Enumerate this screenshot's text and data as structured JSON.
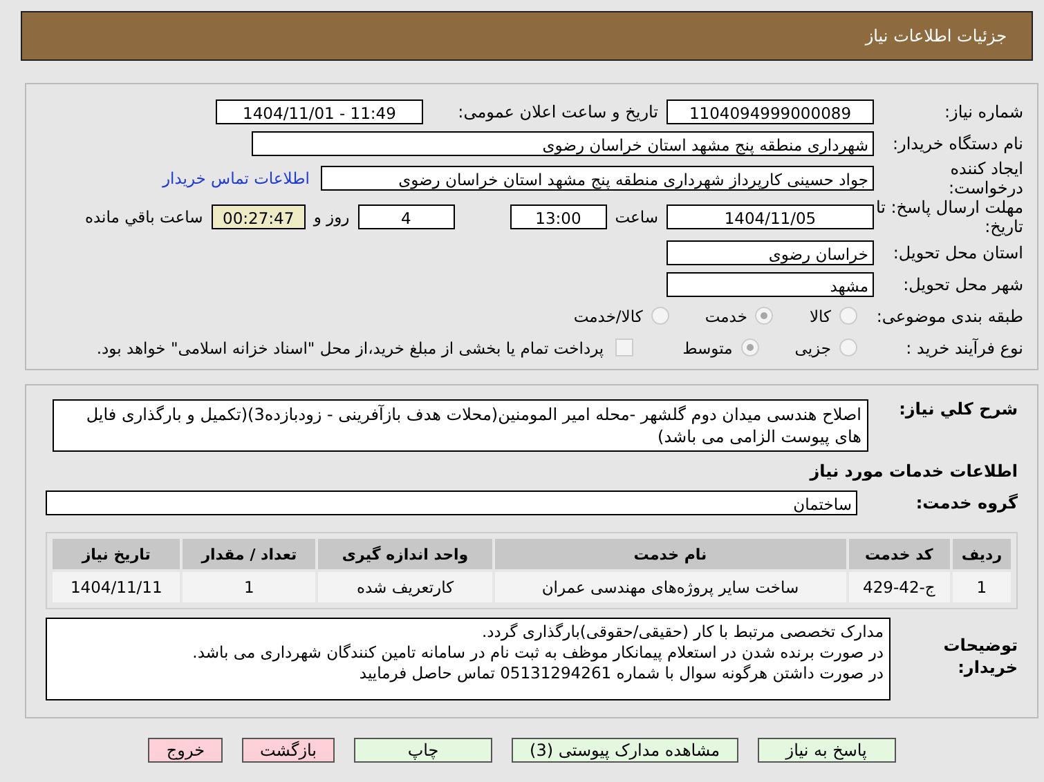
{
  "header": {
    "title": "جزئیات اطلاعات نیاز"
  },
  "info": {
    "need_number_label": "شماره نیاز:",
    "need_number": "1104094999000089",
    "announce_label": "تاریخ و ساعت اعلان عمومی:",
    "announce": "1404/11/01 - 11:49",
    "buyer_label": "نام دستگاه خریدار:",
    "buyer": "شهرداری منطقه پنج مشهد استان خراسان رضوی",
    "creator_label": "ایجاد کننده درخواست:",
    "creator": "جواد حسینی کارپرداز شهرداری منطقه پنج مشهد استان خراسان رضوی",
    "contact_link": "اطلاعات تماس خریدار",
    "deadline_label": "مهلت ارسال پاسخ: تا تاریخ:",
    "deadline_date": "1404/11/05",
    "time_label": "ساعت",
    "deadline_time": "13:00",
    "days": "4",
    "days_label": "روز و",
    "remaining": "00:27:47",
    "remaining_label": "ساعت باقي مانده",
    "province_label": "استان محل تحویل:",
    "province": "خراسان رضوی",
    "city_label": "شهر محل تحویل:",
    "city": "مشهد",
    "category_label": "طبقه بندی موضوعی:",
    "category_options": [
      {
        "label": "کالا",
        "selected": false
      },
      {
        "label": "خدمت",
        "selected": true
      },
      {
        "label": "کالا/خدمت",
        "selected": false
      }
    ],
    "purchase_label": "نوع فرآیند خرید :",
    "purchase_options": [
      {
        "label": "جزیی",
        "selected": false
      },
      {
        "label": "متوسط",
        "selected": true
      }
    ],
    "payment": {
      "checked": false,
      "text": "پرداخت تمام یا بخشی از مبلغ خرید،از محل \"اسناد خزانه اسلامی\" خواهد بود."
    }
  },
  "details": {
    "summary_label": "شرح کلي نیاز:",
    "summary": "اصلاح هندسی میدان دوم گلشهر -محله امیر المومنین(محلات هدف بازآفرینی - زودبازده3)(تکمیل و بارگذاری فایل های پیوست الزامی می باشد)",
    "services_heading": "اطلاعات خدمات مورد نیاز",
    "group_label": "گروه خدمت:",
    "group": "ساختمان",
    "table": {
      "columns": [
        "ردیف",
        "کد خدمت",
        "نام خدمت",
        "واحد اندازه گیری",
        "تعداد / مقدار",
        "تاریخ نیاز"
      ],
      "rows": [
        [
          "1",
          "ج-42-429",
          "ساخت سایر پروژه‌های مهندسی عمران",
          "کارتعریف شده",
          "1",
          "1404/11/11"
        ]
      ]
    },
    "notes_label": "توضیحات خریدار:",
    "notes": [
      "مدارک تخصصی مرتبط با کار (حقیقی/حقوقی)بارگذاری گردد.",
      "در صورت برنده شدن در استعلام پیمانکار موظف به ثبت نام در سامانه تامین کنندگان شهرداری می باشد.",
      "در صورت داشتن هرگونه سوال  با شماره 05131294261 تماس حاصل فرمایید"
    ]
  },
  "buttons": [
    {
      "label": "پاسخ به نیاز",
      "kind": "primary"
    },
    {
      "label": "مشاهده مدارک پیوستی (3)",
      "kind": "primary"
    },
    {
      "label": "چاپ",
      "kind": "primary"
    },
    {
      "label": "بازگشت",
      "kind": "danger"
    },
    {
      "label": "خروج",
      "kind": "danger"
    }
  ]
}
